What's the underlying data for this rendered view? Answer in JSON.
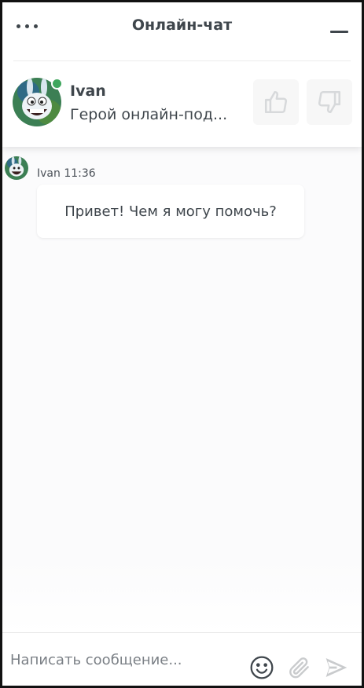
{
  "header": {
    "title": "Онлайн-чат",
    "menu_icon": "more-horizontal-icon",
    "minimize_icon": "minimize-icon"
  },
  "agent": {
    "name": "Ivan",
    "role": "Герой онлайн-под...",
    "status_color": "#3fa65d",
    "avatar_icon": "bunny-avatar-icon"
  },
  "rating": {
    "up_icon": "thumbs-up-icon",
    "down_icon": "thumbs-down-icon"
  },
  "messages": [
    {
      "sender": "Ivan",
      "time": "11:36",
      "meta": "Ivan 11:36",
      "text": "Привет! Чем я могу помочь?"
    }
  ],
  "composer": {
    "placeholder": "Написать сообщение...",
    "emoji_icon": "smiley-icon",
    "attach_icon": "paperclip-icon",
    "send_icon": "send-icon"
  }
}
